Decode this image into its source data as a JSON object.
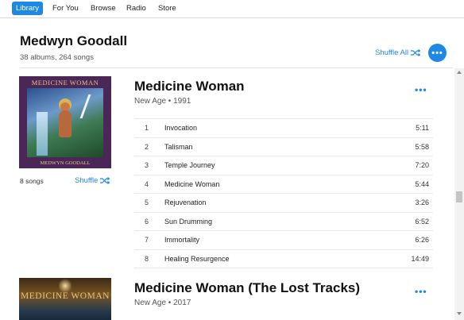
{
  "nav": {
    "tabs": [
      "Library",
      "For You",
      "Browse",
      "Radio",
      "Store"
    ],
    "active": "Library"
  },
  "artist": {
    "name": "Medwyn Goodall",
    "summary": "38 albums, 264 songs",
    "shuffle_all": "Shuffle All"
  },
  "albums": [
    {
      "title": "Medicine Woman",
      "meta": "New Age • 1991",
      "cover_title": "MEDICINE WOMAN",
      "cover_artist": "MEDWYN GOODALL",
      "song_count": "8 songs",
      "shuffle": "Shuffle",
      "tracks": [
        {
          "num": "1",
          "name": "Invocation",
          "dur": "5:11"
        },
        {
          "num": "2",
          "name": "Talisman",
          "dur": "5:58"
        },
        {
          "num": "3",
          "name": "Temple Journey",
          "dur": "7:20"
        },
        {
          "num": "4",
          "name": "Medicine Woman",
          "dur": "5:44"
        },
        {
          "num": "5",
          "name": "Rejuvenation",
          "dur": "3:26"
        },
        {
          "num": "6",
          "name": "Sun Drumming",
          "dur": "6:52"
        },
        {
          "num": "7",
          "name": "Immortality",
          "dur": "6:26"
        },
        {
          "num": "8",
          "name": "Healing Resurgence",
          "dur": "14:49"
        }
      ]
    },
    {
      "title": "Medicine Woman (The Lost Tracks)",
      "meta": "New Age • 2017",
      "cover_title": "MEDICINE WOMAN"
    }
  ],
  "colors": {
    "accent": "#1e88e5",
    "active_tab_bg": "#1e88e5"
  },
  "icons": {
    "shuffle": "shuffle-icon",
    "more": "more-icon"
  }
}
